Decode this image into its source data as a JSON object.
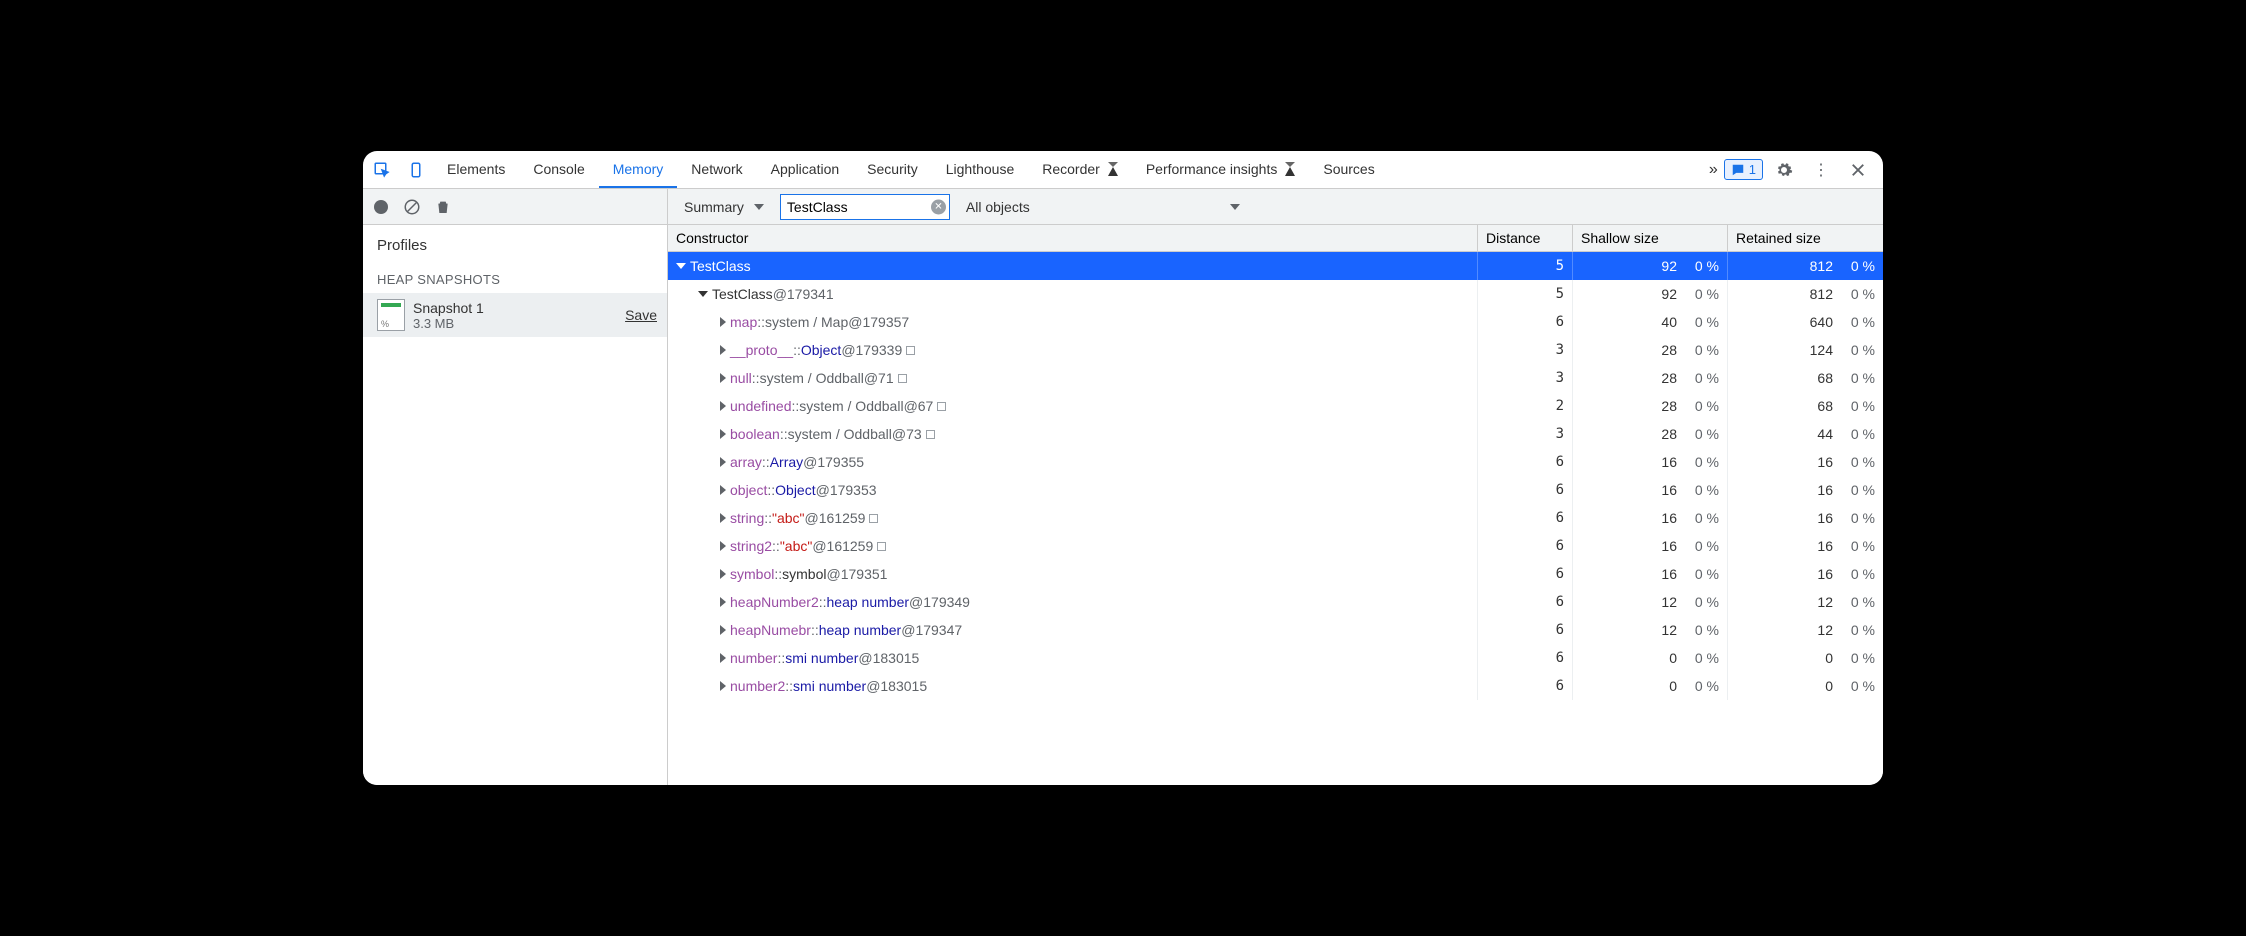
{
  "tabs": [
    "Elements",
    "Console",
    "Memory",
    "Network",
    "Application",
    "Security",
    "Lighthouse",
    "Recorder",
    "Performance insights",
    "Sources"
  ],
  "activeTab": "Memory",
  "issueCount": "1",
  "toolbar": {
    "summary": "Summary",
    "filterValue": "TestClass",
    "allObjects": "All objects"
  },
  "sidebar": {
    "profiles": "Profiles",
    "heading": "HEAP SNAPSHOTS",
    "snapName": "Snapshot 1",
    "snapSize": "3.3 MB",
    "save": "Save"
  },
  "headers": {
    "constructor": "Constructor",
    "distance": "Distance",
    "shallow": "Shallow size",
    "retained": "Retained size"
  },
  "rows": [
    {
      "indent": 0,
      "arrow": "d",
      "selected": true,
      "parts": [
        {
          "t": "TestClass"
        }
      ],
      "dist": "5",
      "sh": "92",
      "shp": "0 %",
      "ret": "812",
      "retp": "0 %"
    },
    {
      "indent": 1,
      "arrow": "d",
      "parts": [
        {
          "t": "TestClass"
        },
        {
          "t": " @179341",
          "c": "gray"
        }
      ],
      "dist": "5",
      "sh": "92",
      "shp": "0 %",
      "ret": "812",
      "retp": "0 %"
    },
    {
      "indent": 2,
      "arrow": "r",
      "parts": [
        {
          "t": "map",
          "c": "prop"
        },
        {
          "t": " :: ",
          "c": "gray"
        },
        {
          "t": "system / Map",
          "c": "gray"
        },
        {
          "t": " @179357",
          "c": "gray"
        }
      ],
      "dist": "6",
      "sh": "40",
      "shp": "0 %",
      "ret": "640",
      "retp": "0 %"
    },
    {
      "indent": 2,
      "arrow": "r",
      "parts": [
        {
          "t": "__proto__",
          "c": "prop"
        },
        {
          "t": " :: ",
          "c": "gray"
        },
        {
          "t": "Object",
          "c": "typ"
        },
        {
          "t": " @179339",
          "c": "gray"
        }
      ],
      "box": true,
      "dist": "3",
      "sh": "28",
      "shp": "0 %",
      "ret": "124",
      "retp": "0 %"
    },
    {
      "indent": 2,
      "arrow": "r",
      "parts": [
        {
          "t": "null",
          "c": "prop"
        },
        {
          "t": " :: ",
          "c": "gray"
        },
        {
          "t": "system / Oddball",
          "c": "gray"
        },
        {
          "t": " @71",
          "c": "gray"
        }
      ],
      "box": true,
      "dist": "3",
      "sh": "28",
      "shp": "0 %",
      "ret": "68",
      "retp": "0 %"
    },
    {
      "indent": 2,
      "arrow": "r",
      "parts": [
        {
          "t": "undefined",
          "c": "prop"
        },
        {
          "t": " :: ",
          "c": "gray"
        },
        {
          "t": "system / Oddball",
          "c": "gray"
        },
        {
          "t": " @67",
          "c": "gray"
        }
      ],
      "box": true,
      "dist": "2",
      "sh": "28",
      "shp": "0 %",
      "ret": "68",
      "retp": "0 %"
    },
    {
      "indent": 2,
      "arrow": "r",
      "parts": [
        {
          "t": "boolean",
          "c": "prop"
        },
        {
          "t": " :: ",
          "c": "gray"
        },
        {
          "t": "system / Oddball",
          "c": "gray"
        },
        {
          "t": " @73",
          "c": "gray"
        }
      ],
      "box": true,
      "dist": "3",
      "sh": "28",
      "shp": "0 %",
      "ret": "44",
      "retp": "0 %"
    },
    {
      "indent": 2,
      "arrow": "r",
      "parts": [
        {
          "t": "array",
          "c": "prop"
        },
        {
          "t": " :: ",
          "c": "gray"
        },
        {
          "t": "Array",
          "c": "typ"
        },
        {
          "t": " @179355",
          "c": "gray"
        }
      ],
      "dist": "6",
      "sh": "16",
      "shp": "0 %",
      "ret": "16",
      "retp": "0 %"
    },
    {
      "indent": 2,
      "arrow": "r",
      "parts": [
        {
          "t": "object",
          "c": "prop"
        },
        {
          "t": " :: ",
          "c": "gray"
        },
        {
          "t": "Object",
          "c": "typ"
        },
        {
          "t": " @179353",
          "c": "gray"
        }
      ],
      "dist": "6",
      "sh": "16",
      "shp": "0 %",
      "ret": "16",
      "retp": "0 %"
    },
    {
      "indent": 2,
      "arrow": "r",
      "parts": [
        {
          "t": "string",
          "c": "prop"
        },
        {
          "t": " :: ",
          "c": "gray"
        },
        {
          "t": "\"abc\"",
          "c": "str"
        },
        {
          "t": " @161259",
          "c": "gray"
        }
      ],
      "box": true,
      "dist": "6",
      "sh": "16",
      "shp": "0 %",
      "ret": "16",
      "retp": "0 %"
    },
    {
      "indent": 2,
      "arrow": "r",
      "parts": [
        {
          "t": "string2",
          "c": "prop"
        },
        {
          "t": " :: ",
          "c": "gray"
        },
        {
          "t": "\"abc\"",
          "c": "str"
        },
        {
          "t": " @161259",
          "c": "gray"
        }
      ],
      "box": true,
      "dist": "6",
      "sh": "16",
      "shp": "0 %",
      "ret": "16",
      "retp": "0 %"
    },
    {
      "indent": 2,
      "arrow": "r",
      "parts": [
        {
          "t": "symbol",
          "c": "prop"
        },
        {
          "t": " :: ",
          "c": "gray"
        },
        {
          "t": "symbol"
        },
        {
          "t": " @179351",
          "c": "gray"
        }
      ],
      "dist": "6",
      "sh": "16",
      "shp": "0 %",
      "ret": "16",
      "retp": "0 %"
    },
    {
      "indent": 2,
      "arrow": "r",
      "parts": [
        {
          "t": "heapNumber2",
          "c": "prop"
        },
        {
          "t": " :: ",
          "c": "gray"
        },
        {
          "t": "heap number",
          "c": "typ"
        },
        {
          "t": " @179349",
          "c": "gray"
        }
      ],
      "dist": "6",
      "sh": "12",
      "shp": "0 %",
      "ret": "12",
      "retp": "0 %"
    },
    {
      "indent": 2,
      "arrow": "r",
      "parts": [
        {
          "t": "heapNumebr",
          "c": "prop"
        },
        {
          "t": " :: ",
          "c": "gray"
        },
        {
          "t": "heap number",
          "c": "typ"
        },
        {
          "t": " @179347",
          "c": "gray"
        }
      ],
      "dist": "6",
      "sh": "12",
      "shp": "0 %",
      "ret": "12",
      "retp": "0 %"
    },
    {
      "indent": 2,
      "arrow": "r",
      "parts": [
        {
          "t": "number",
          "c": "prop"
        },
        {
          "t": " :: ",
          "c": "gray"
        },
        {
          "t": "smi number",
          "c": "typ"
        },
        {
          "t": " @183015",
          "c": "gray"
        }
      ],
      "dist": "6",
      "sh": "0",
      "shp": "0 %",
      "ret": "0",
      "retp": "0 %"
    },
    {
      "indent": 2,
      "arrow": "r",
      "parts": [
        {
          "t": "number2",
          "c": "prop"
        },
        {
          "t": " :: ",
          "c": "gray"
        },
        {
          "t": "smi number",
          "c": "typ"
        },
        {
          "t": " @183015",
          "c": "gray"
        }
      ],
      "dist": "6",
      "sh": "0",
      "shp": "0 %",
      "ret": "0",
      "retp": "0 %"
    }
  ]
}
